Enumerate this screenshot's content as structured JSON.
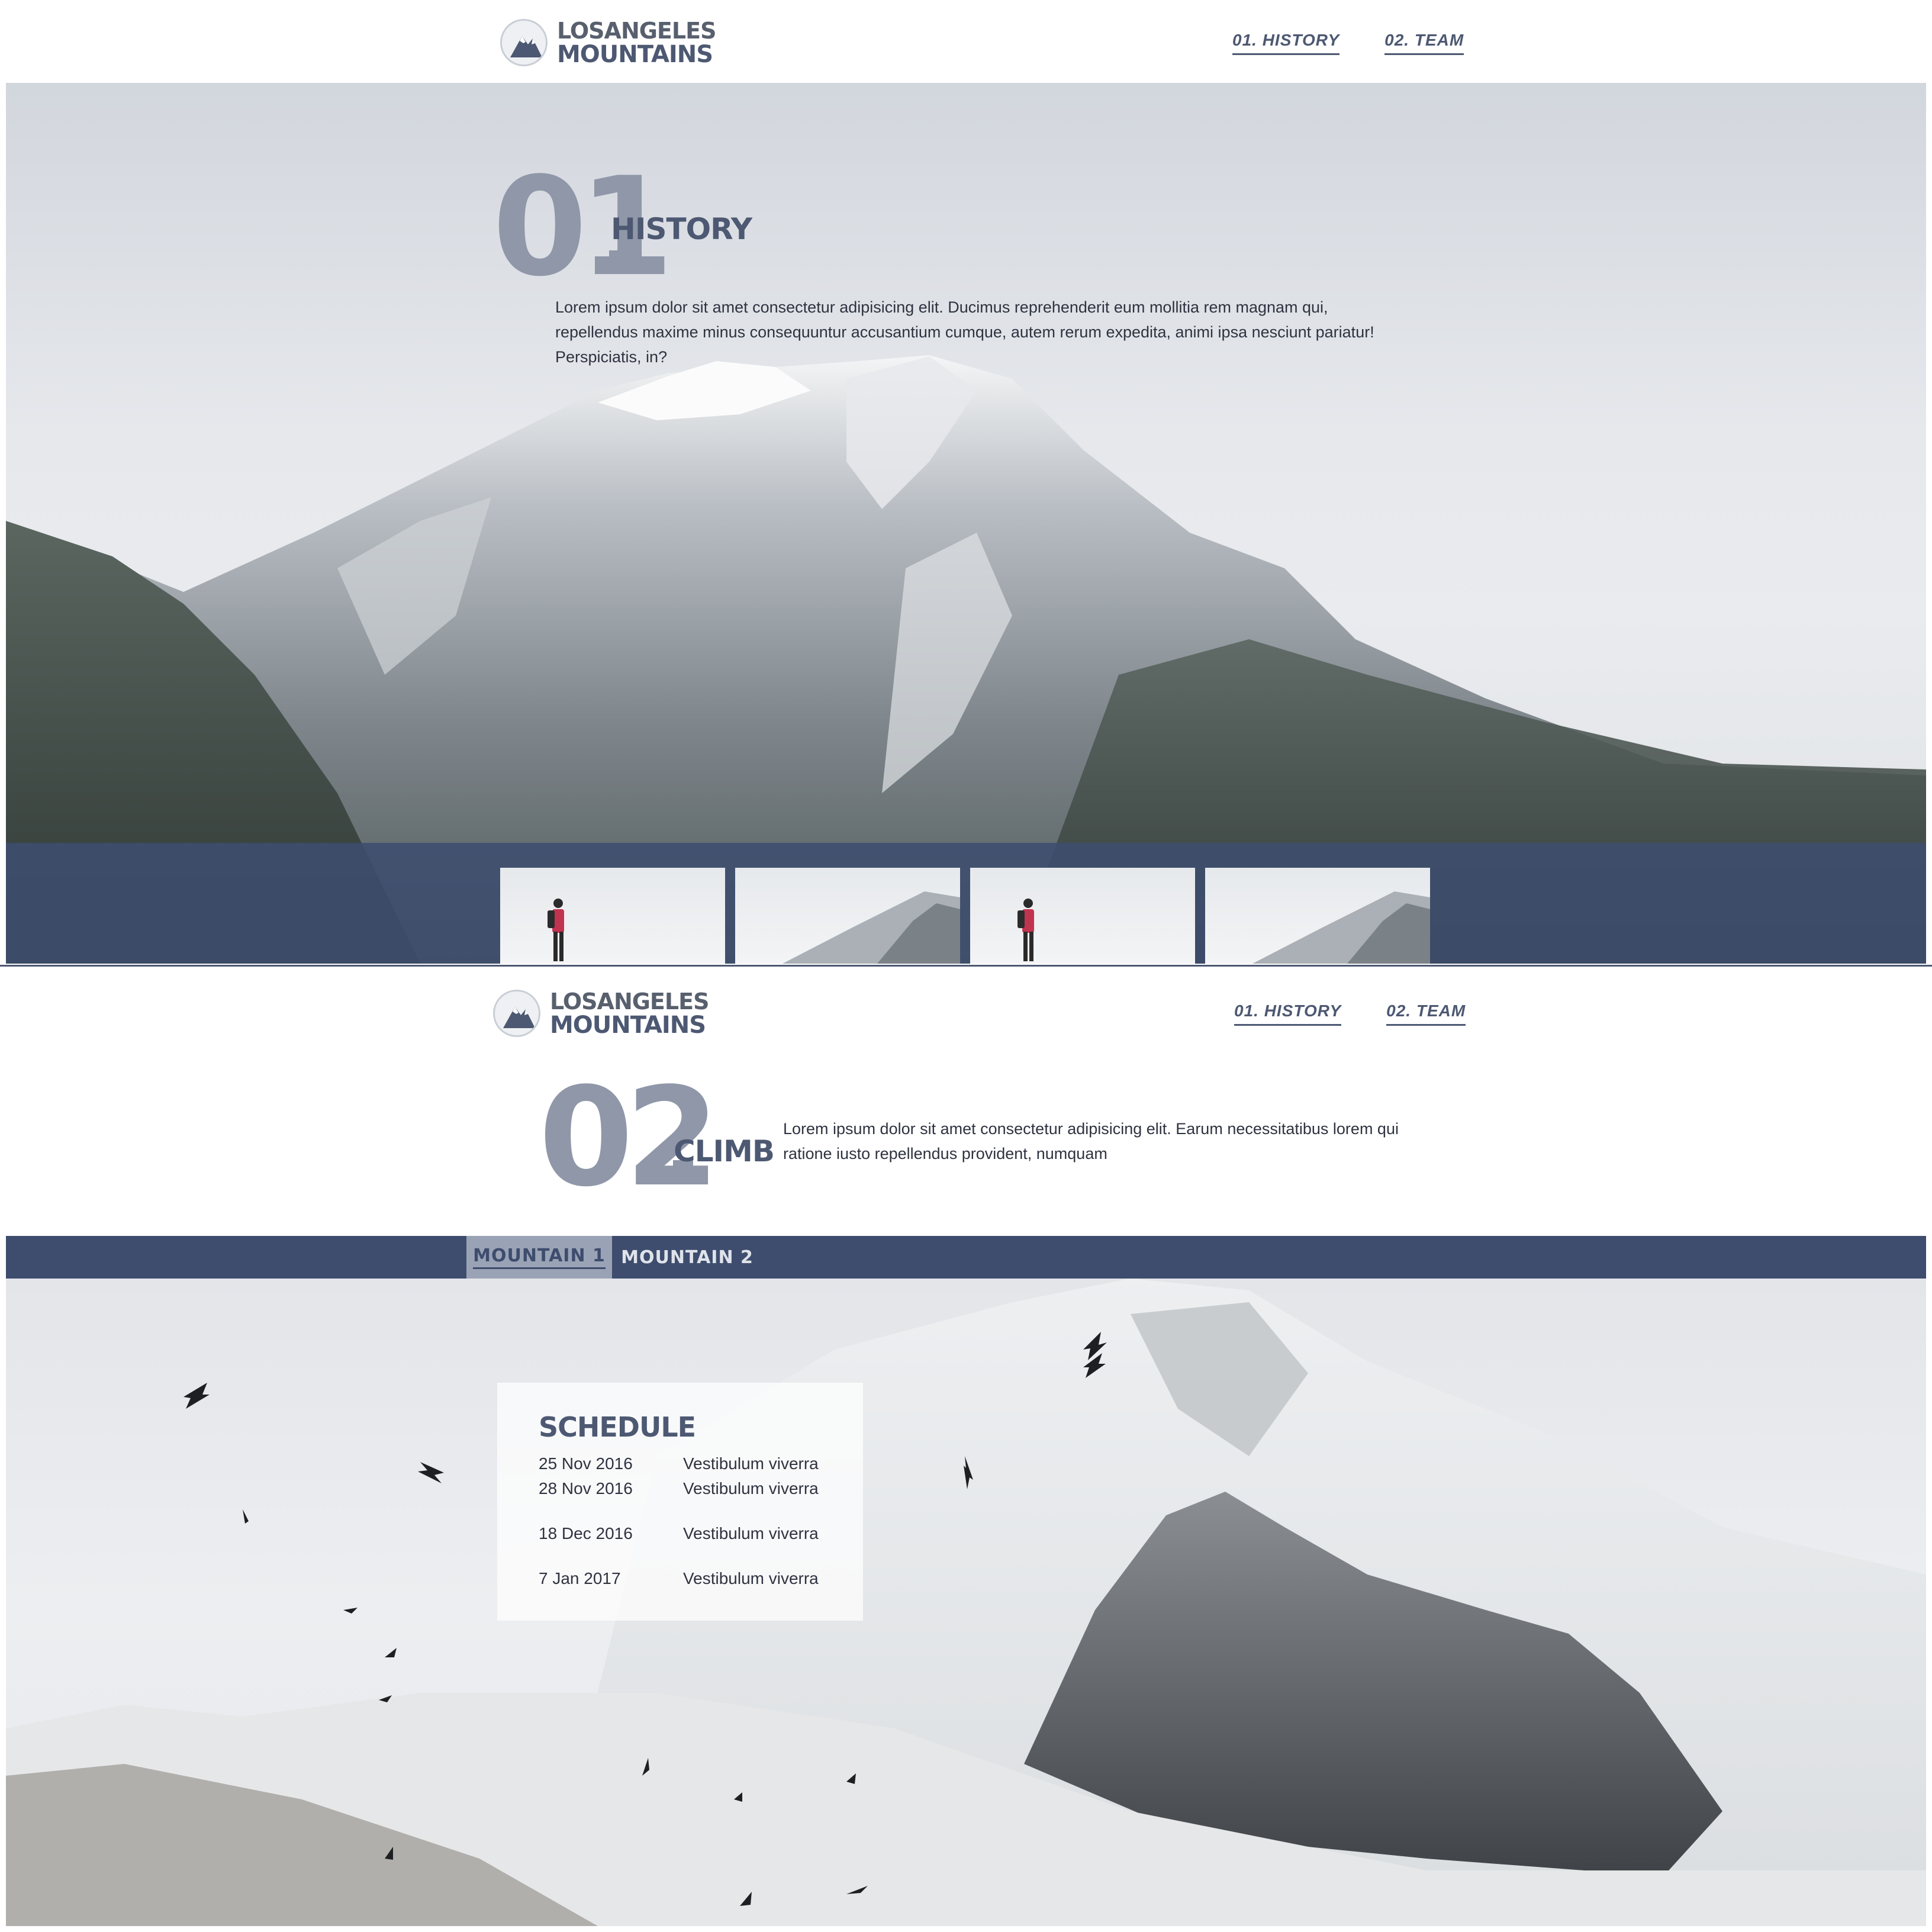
{
  "brand": {
    "line1": "LOSANGELES",
    "line2": "MOUNTAINS"
  },
  "nav": {
    "history": "01. HISTORY",
    "team": "02. TEAM"
  },
  "history": {
    "number": "01",
    "title": "HISTORY",
    "text": "Lorem ipsum dolor sit amet consectetur adipisicing elit. Ducimus reprehenderit eum mollitia rem magnam qui, repellendus maxime minus consequuntur accusantium cumque, autem rerum expedita, animi ipsa nesciunt pariatur! Perspiciatis, in?"
  },
  "gallery": {
    "thumbnails": [
      "hiker",
      "misty-mountain",
      "hiker",
      "misty-mountain"
    ]
  },
  "climb": {
    "number": "02",
    "title": "CLIMB",
    "text": "Lorem ipsum dolor sit amet consectetur adipisicing elit. Earum necessitatibus lorem qui ratione iusto repellendus provident, numquam"
  },
  "tabs": [
    {
      "label": "MOUNTAIN 1",
      "active": true
    },
    {
      "label": "MOUNTAIN 2",
      "active": false
    }
  ],
  "schedule": {
    "title": "SCHEDULE",
    "rows": [
      {
        "date": "25 Nov 2016",
        "text": "Vestibulum viverra"
      },
      {
        "date": "28 Nov 2016",
        "text": "Vestibulum viverra"
      },
      {
        "date": "18 Dec 2016",
        "text": "Vestibulum viverra"
      },
      {
        "date": "7 Jan 2017",
        "text": "Vestibulum viverra"
      }
    ]
  },
  "colors": {
    "accent": "#4d5872",
    "muted_number": "#8f97a8",
    "bar": "#3e4d6e"
  }
}
